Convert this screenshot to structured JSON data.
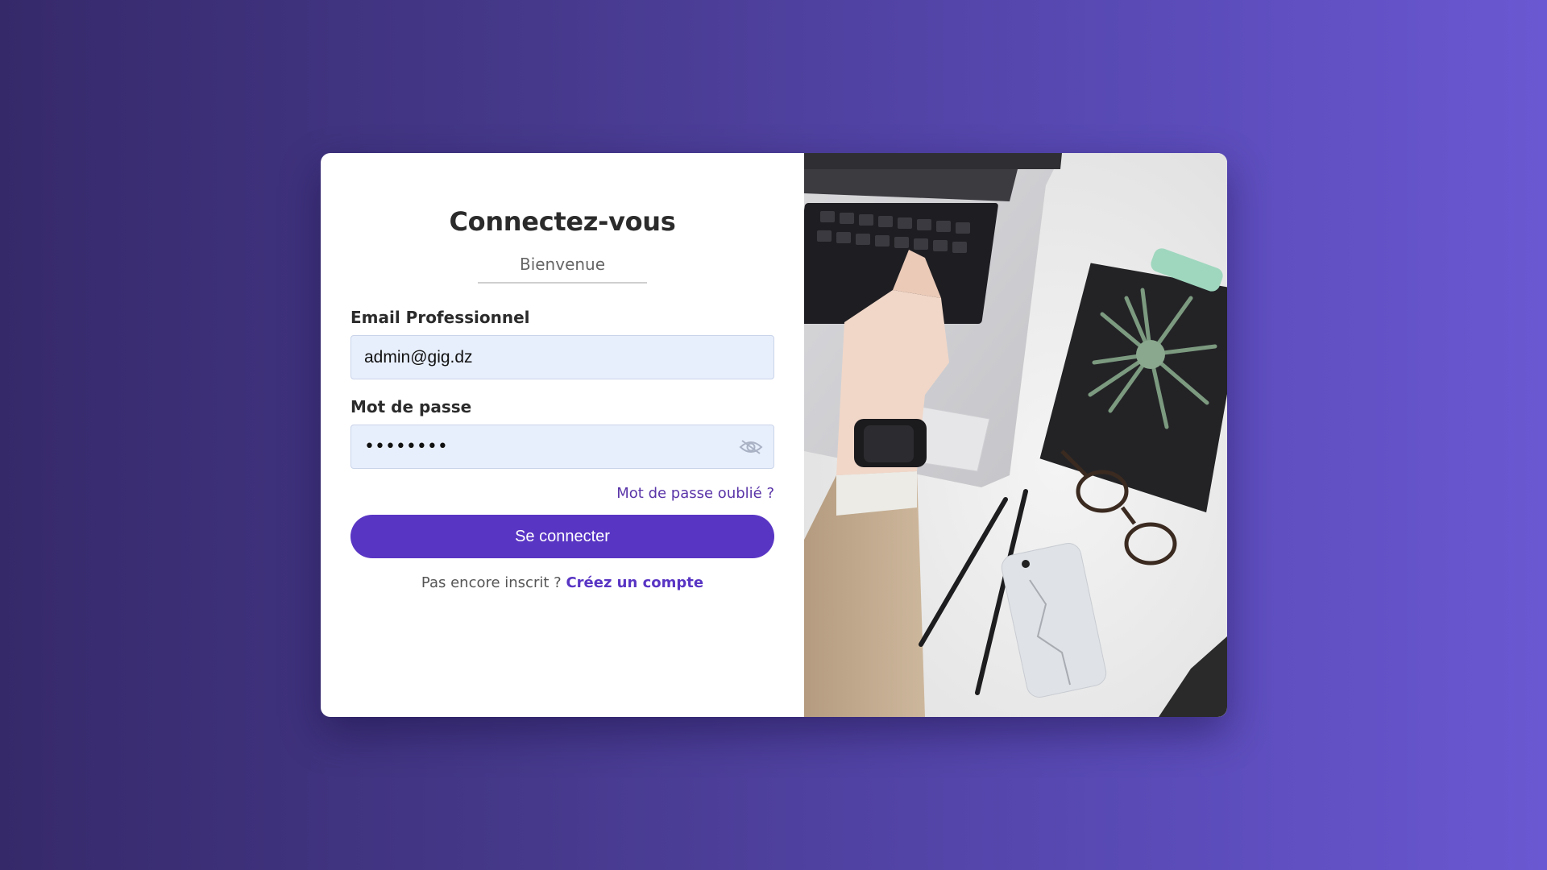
{
  "login": {
    "title": "Connectez-vous",
    "subtitle": "Bienvenue",
    "email_label": "Email Professionnel",
    "email_value": "admin@gig.dz",
    "password_label": "Mot de passe",
    "password_value": "••••••••",
    "forgot_link": "Mot de passe oublié ?",
    "submit_label": "Se connecter",
    "signup_prompt": "Pas encore inscrit ?",
    "signup_link": "Créez un compte"
  },
  "icons": {
    "password_toggle": "eye-off-icon"
  },
  "colors": {
    "accent": "#5935c4",
    "link": "#5a35a8",
    "input_bg": "#e8effc",
    "background_start": "#36296a",
    "background_end": "#6a58d2"
  }
}
